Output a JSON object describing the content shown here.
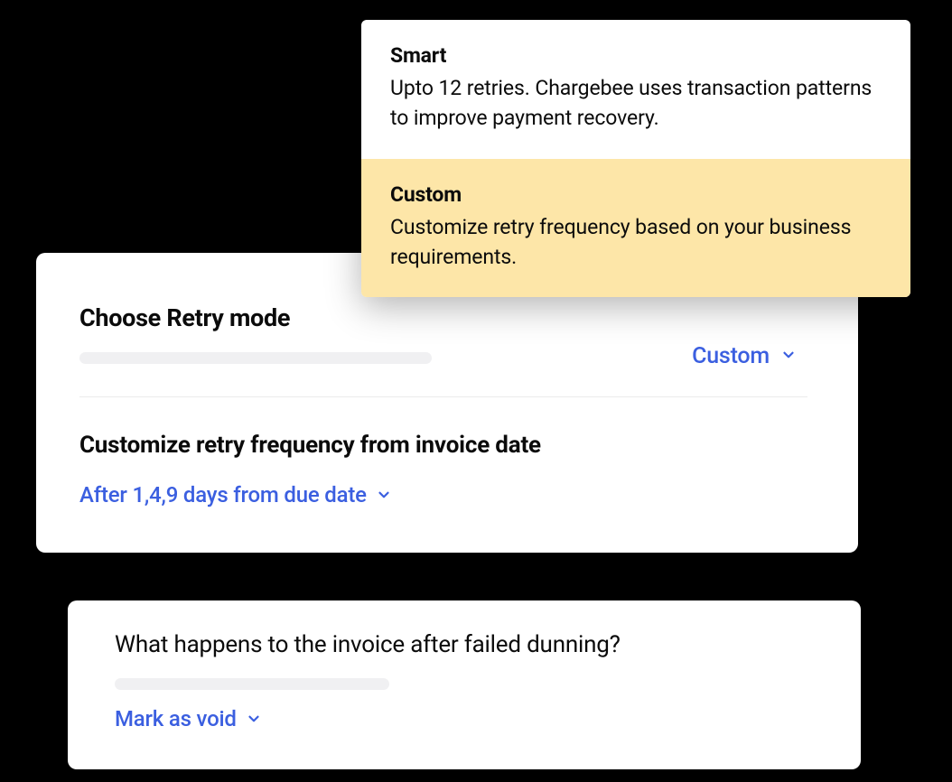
{
  "dropdown": {
    "options": [
      {
        "title": "Smart",
        "desc": "Upto 12 retries. Chargebee uses transaction patterns to improve payment recovery."
      },
      {
        "title": "Custom",
        "desc": "Customize retry frequency based on your business requirements."
      }
    ]
  },
  "retry_mode": {
    "title": "Choose Retry mode",
    "selected": "Custom"
  },
  "customize": {
    "title": "Customize retry frequency from invoice date",
    "value": "After 1,4,9 days from due date"
  },
  "dunning": {
    "question": "What happens to the invoice after failed dunning?",
    "value": "Mark as void"
  },
  "colors": {
    "accent": "#3b5fe0",
    "highlight": "#FDE6A8"
  }
}
